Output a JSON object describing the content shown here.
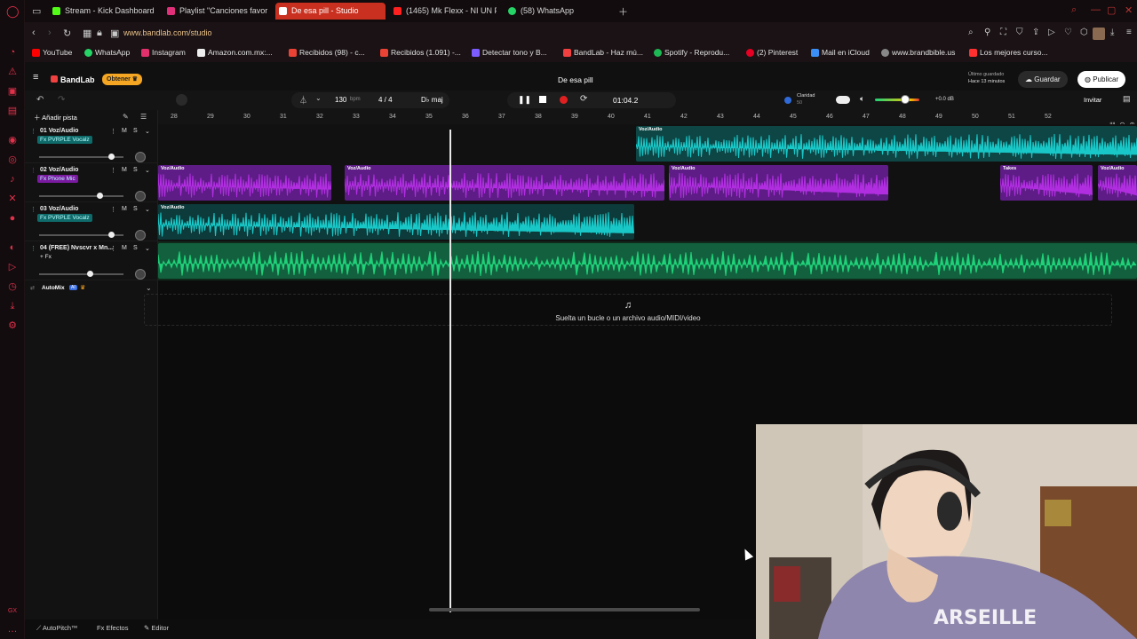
{
  "browser": {
    "tabs": [
      {
        "label": "Stream - Kick Dashboard",
        "color": "#53fc18"
      },
      {
        "label": "Playlist \"Canciones favor",
        "color": "#e0307a"
      },
      {
        "label": "De esa pill - Studio",
        "color": "#f04040"
      },
      {
        "label": "(1465) Mk Flexx - NI UN P",
        "color": "#ff2020"
      },
      {
        "label": "(58) WhatsApp",
        "color": "#25d366"
      }
    ],
    "url": "www.bandlab.com/studio",
    "bookmarks": [
      {
        "label": "YouTube",
        "color": "#ff0000"
      },
      {
        "label": "WhatsApp",
        "color": "#25d366"
      },
      {
        "label": "Instagram",
        "color": "#e1306c"
      },
      {
        "label": "Amazon.com.mx:...",
        "color": "#eeeeee"
      },
      {
        "label": "Recibidos (98) - c...",
        "color": "#ea4335"
      },
      {
        "label": "Recibidos (1.091) -...",
        "color": "#ea4335"
      },
      {
        "label": "Detectar tono y B...",
        "color": "#7a5cff"
      },
      {
        "label": "BandLab - Haz mú...",
        "color": "#f04040"
      },
      {
        "label": "Spotify - Reprodu...",
        "color": "#1db954"
      },
      {
        "label": "(2) Pinterest",
        "color": "#e60023"
      },
      {
        "label": "Mail en iCloud",
        "color": "#3a8ef6"
      },
      {
        "label": "www.brandbible.us",
        "color": "#888888"
      },
      {
        "label": "Los mejores curso...",
        "color": "#ff3030"
      }
    ]
  },
  "bandlab": {
    "logo": "BandLab",
    "obtener": "Obtener",
    "project_title": "De esa pill",
    "last_saved_label": "Último guardado",
    "last_saved_time": "Hace 13 minutos",
    "save_label": "Guardar",
    "publish_label": "Publicar",
    "invite_label": "Invitar",
    "bpm": "130",
    "bpm_unit": "bpm",
    "time_sig": "4 / 4",
    "key": "D♭ maj",
    "time": "01:04.2",
    "claridad_label": "Claridad",
    "claridad_value": "50",
    "db": "+0.0 dB",
    "add_track": "Añadir pista",
    "automix": "AutoMix",
    "drop_text": "Suelta un bucle o un archivo audio/MIDI/video",
    "bottom": {
      "autopitch": "AutoPitch™",
      "efectos": "Efectos",
      "editor": "Editor"
    },
    "bars": [
      "28",
      "29",
      "30",
      "31",
      "32",
      "33",
      "34",
      "35",
      "36",
      "37",
      "38",
      "39",
      "40",
      "41",
      "42",
      "43",
      "44",
      "45",
      "46",
      "47",
      "48",
      "49",
      "50",
      "51",
      "52"
    ],
    "tracks": [
      {
        "name": "01  Voz/Audio",
        "fx": "Fx PVRPLE Vocalz",
        "color": "#19c7c7",
        "fx_color": "#0f6a6a",
        "volume": 0.85
      },
      {
        "name": "02  Voz/Audio",
        "fx": "Fx Phone Mic",
        "color": "#b02ee0",
        "fx_color": "#7a1aa0",
        "volume": 0.72
      },
      {
        "name": "03  Voz/Audio",
        "fx": "Fx PVRPLE Vocalz",
        "color": "#19c7c7",
        "fx_color": "#0f6a6a",
        "volume": 0.85
      },
      {
        "name": "04  (FREE) Nvscvr x Mn...",
        "fx": "+ Fx",
        "color": "#1fd178",
        "fx_color": "transparent",
        "volume": 0.6
      }
    ],
    "clip_labels": {
      "audio": "Voz/Audio",
      "takes": "Takes"
    }
  }
}
